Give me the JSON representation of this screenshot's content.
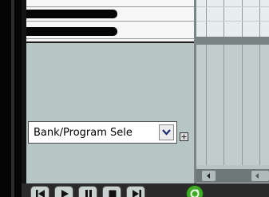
{
  "cc_lane": {
    "selected": "Bank/Program Sele",
    "options": [
      "Bank/Program Sele"
    ]
  },
  "icons": {
    "dropdown": "chevron-down-icon",
    "add_lane": "plus-icon",
    "scroll_left": "arrow-left-icon",
    "transport": [
      "skip-back-icon",
      "play-icon",
      "pause-icon",
      "stop-icon",
      "skip-forward-icon",
      "loop-icon"
    ]
  },
  "colors": {
    "background": "#b9c3c3",
    "loop_active": "#43a82c",
    "piano_black": "#050505"
  }
}
